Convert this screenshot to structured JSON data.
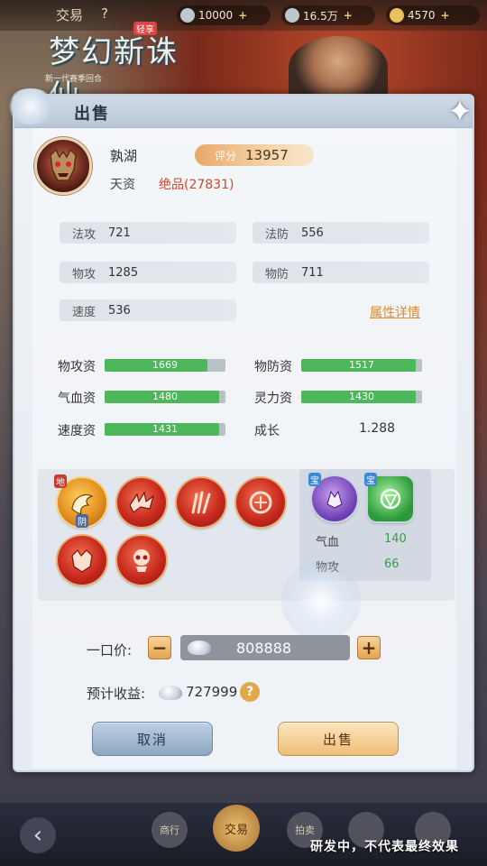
{
  "topbar": {
    "tab_label": "交易",
    "help_char": "?",
    "currencies": [
      {
        "icon": "jade-coin-icon",
        "value": "10000"
      },
      {
        "icon": "silver-ingot-icon",
        "value": "16.5万"
      },
      {
        "icon": "gold-coin-icon",
        "value": "4570"
      }
    ]
  },
  "logo": {
    "title": "梦幻新诛仙",
    "badge": "轻享",
    "subtitle": "新一代赛季回合"
  },
  "dialog": {
    "title": "出售",
    "close_icon": "close-icon"
  },
  "pet": {
    "name": "孰湖",
    "score_label": "评分",
    "score": "13957",
    "talent_label": "天资",
    "talent_value": "绝品(27831)"
  },
  "stats": [
    {
      "label": "法攻",
      "value": "721"
    },
    {
      "label": "法防",
      "value": "556"
    },
    {
      "label": "物攻",
      "value": "1285"
    },
    {
      "label": "物防",
      "value": "711"
    },
    {
      "label": "速度",
      "value": "536"
    }
  ],
  "detail_link": "属性详情",
  "aptitudes": [
    {
      "label": "物攻资",
      "value": "1669",
      "fill": 0.85
    },
    {
      "label": "物防资",
      "value": "1517",
      "fill": 0.95
    },
    {
      "label": "气血资",
      "value": "1480",
      "fill": 0.95
    },
    {
      "label": "灵力资",
      "value": "1430",
      "fill": 0.95
    },
    {
      "label": "速度资",
      "value": "1431",
      "fill": 0.95
    }
  ],
  "growth": {
    "label": "成长",
    "value": "1.288"
  },
  "skills": [
    {
      "icon": "golden-dragon-skill-icon",
      "badge": "地",
      "sub_badge": "阴"
    },
    {
      "icon": "bat-wing-skill-icon"
    },
    {
      "icon": "claw-skill-icon"
    },
    {
      "icon": "shield-skill-icon"
    },
    {
      "icon": "beast-head-skill-icon"
    },
    {
      "icon": "skull-skill-icon"
    }
  ],
  "treasures": [
    {
      "icon": "purple-beast-treasure-icon",
      "badge": "宝"
    },
    {
      "icon": "green-seal-treasure-icon",
      "badge": "宝"
    }
  ],
  "treasure_stats": [
    {
      "label": "气血",
      "value": "140"
    },
    {
      "label": "物攻",
      "value": "66"
    }
  ],
  "price": {
    "label": "一口价:",
    "value": "808888",
    "minus": "−",
    "plus": "+"
  },
  "income": {
    "label": "预计收益:",
    "value": "727999",
    "help": "?"
  },
  "buttons": {
    "cancel": "取消",
    "sell": "出售"
  },
  "bottom_nav": {
    "back": "‹",
    "items": [
      "商行",
      "交易",
      "拍卖",
      "",
      ""
    ]
  },
  "watermark": "研发中，不代表最终效果"
}
